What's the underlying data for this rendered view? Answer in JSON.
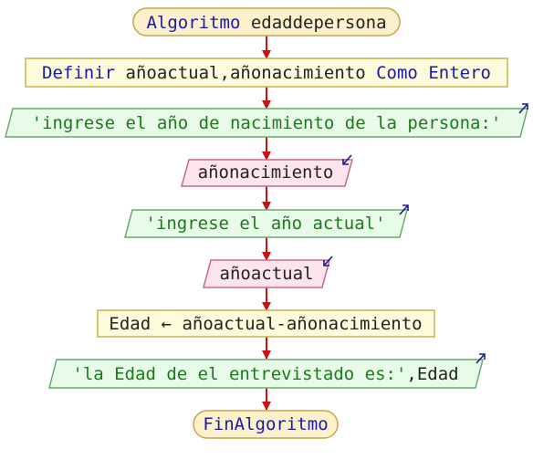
{
  "colors": {
    "keyword": "#1a1aa6",
    "string": "#1a7a1a",
    "variable": "#222222",
    "connector": "#cc1111",
    "io_arrow": "#1a1a8c",
    "terminal_fill": "#fdf1cc",
    "terminal_stroke": "#c9a24a",
    "process_fill": "#fefadc",
    "process_stroke": "#c9b24a",
    "output_fill": "#e8fbe8",
    "output_stroke": "#6aaa6a",
    "input_fill": "#fde4ef",
    "input_stroke": "#c66a8a"
  },
  "flowchart": {
    "start": {
      "keyword": "Algoritmo",
      "name": " edaddepersona"
    },
    "definir": {
      "keyword": "Definir",
      "vars": " añoactual,añonacimiento ",
      "keyword2": "Como",
      "space": " ",
      "type": "Entero"
    },
    "output_1": {
      "text": "'ingrese el año de nacimiento de la persona:'",
      "io_icon": "output-arrow-icon"
    },
    "input_1": {
      "text": "añonacimiento",
      "io_icon": "input-arrow-icon"
    },
    "output_2": {
      "text": "'ingrese el año actual'",
      "io_icon": "output-arrow-icon"
    },
    "input_2": {
      "text": "añoactual",
      "io_icon": "input-arrow-icon"
    },
    "assign": {
      "text": "Edad ← añoactual-añonacimiento"
    },
    "output_3": {
      "string": "'la Edad de el entrevistado es:'",
      "rest": ",Edad",
      "io_icon": "output-arrow-icon"
    },
    "end": {
      "keyword": "FinAlgoritmo"
    }
  }
}
